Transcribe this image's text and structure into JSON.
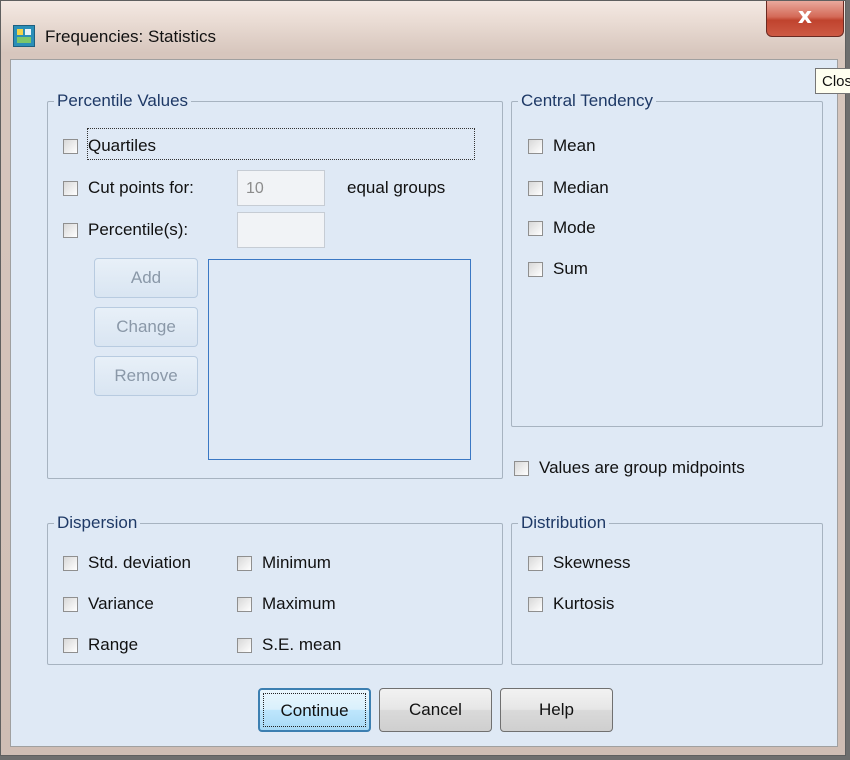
{
  "window": {
    "title": "Frequencies: Statistics",
    "close_glyph": "x",
    "tooltip": "Close",
    "icon": "spss-table-icon",
    "colors": {
      "close_button": "#c0432e",
      "client_bg": "#dfe9f5",
      "group_label": "#1e3966",
      "listbox_border": "#3a78c4"
    }
  },
  "percentile_values": {
    "legend": "Percentile Values",
    "quartiles": {
      "label": "Quartiles",
      "checked": false
    },
    "cut_points": {
      "label": "Cut points for:",
      "value": "10",
      "suffix": "equal groups",
      "checked": false
    },
    "percentiles": {
      "label": "Percentile(s):",
      "value": "",
      "checked": false
    },
    "buttons": {
      "add": "Add",
      "change": "Change",
      "remove": "Remove"
    }
  },
  "central_tendency": {
    "legend": "Central Tendency",
    "items": [
      {
        "label": "Mean",
        "checked": false
      },
      {
        "label": "Median",
        "checked": false
      },
      {
        "label": "Mode",
        "checked": false
      },
      {
        "label": "Sum",
        "checked": false
      }
    ]
  },
  "group_midpoints": {
    "label": "Values are group midpoints",
    "checked": false
  },
  "dispersion": {
    "legend": "Dispersion",
    "items": [
      {
        "label": "Std. deviation",
        "checked": false
      },
      {
        "label": "Minimum",
        "checked": false
      },
      {
        "label": "Variance",
        "checked": false
      },
      {
        "label": "Maximum",
        "checked": false
      },
      {
        "label": "Range",
        "checked": false
      },
      {
        "label": "S.E. mean",
        "checked": false
      }
    ]
  },
  "distribution": {
    "legend": "Distribution",
    "items": [
      {
        "label": "Skewness",
        "checked": false
      },
      {
        "label": "Kurtosis",
        "checked": false
      }
    ]
  },
  "footer": {
    "continue": "Continue",
    "cancel": "Cancel",
    "help": "Help"
  }
}
